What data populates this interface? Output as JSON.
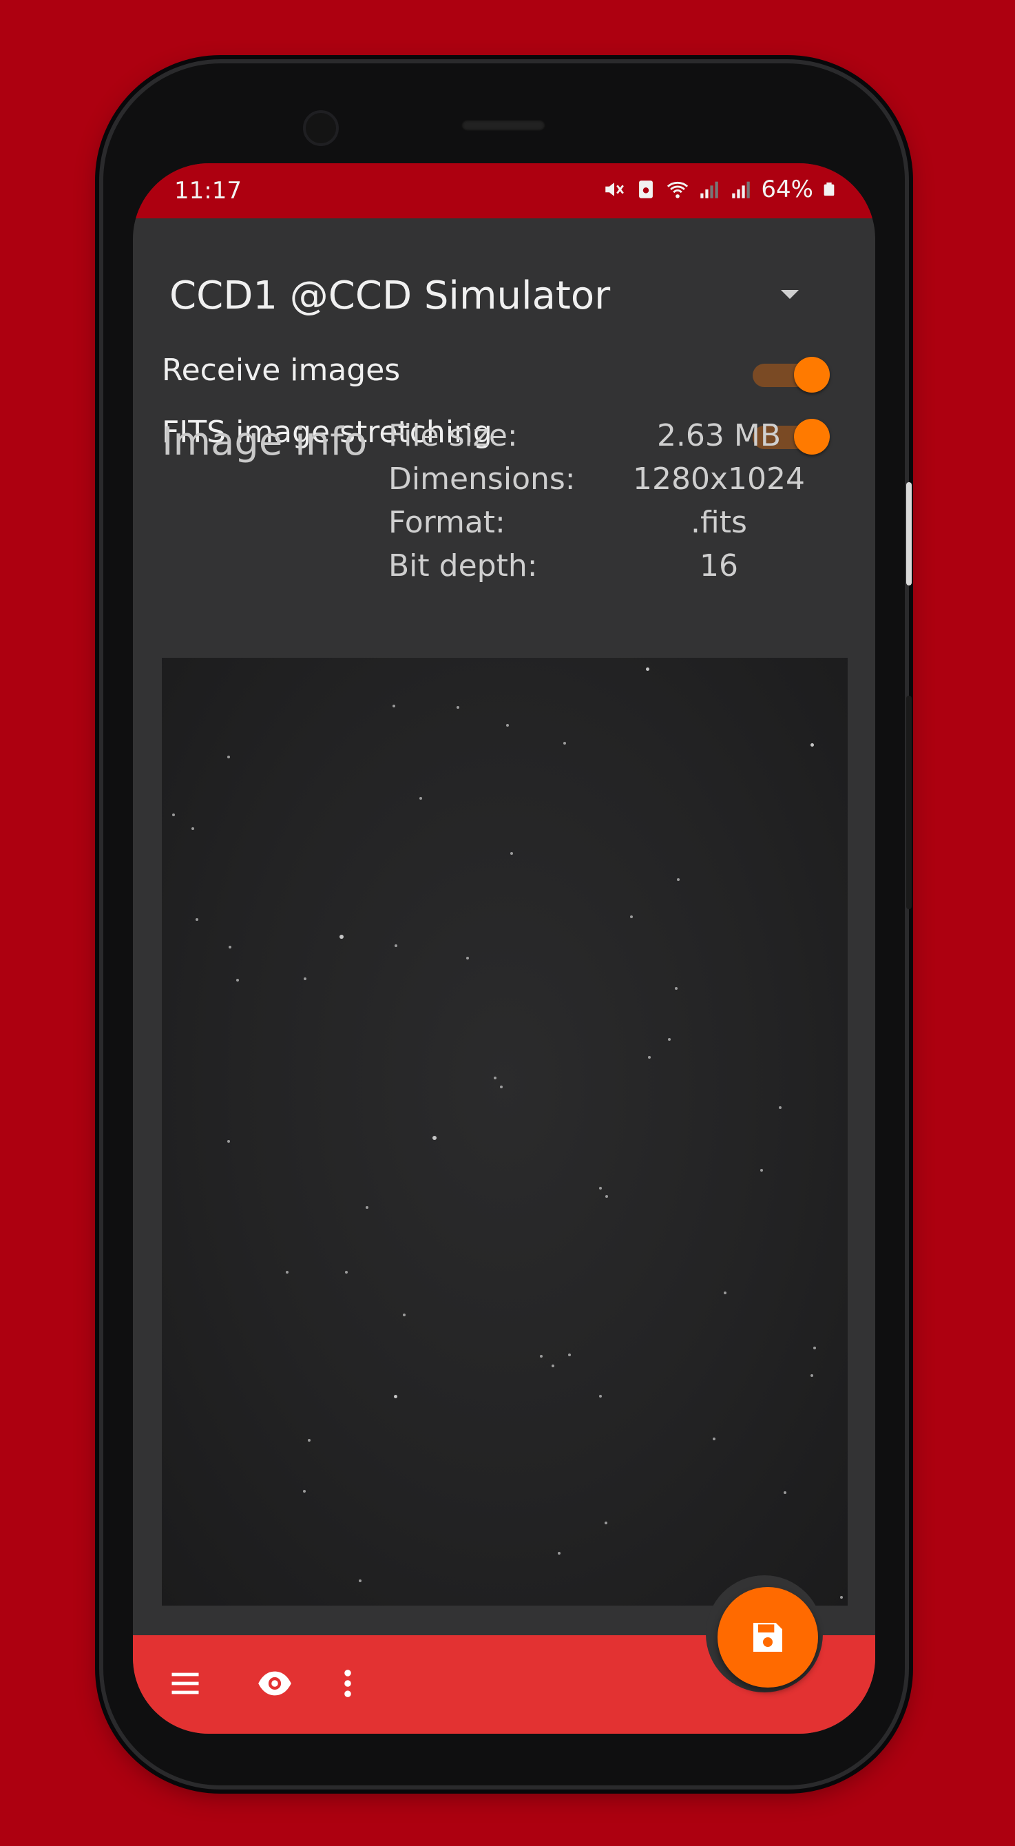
{
  "status_bar": {
    "time": "11:17",
    "battery": "64%"
  },
  "device_selector": {
    "selected": "CCD1 @CCD Simulator"
  },
  "toggles": [
    {
      "label": "Receive images",
      "on": true
    },
    {
      "label": "FITS image stretching",
      "on": true
    }
  ],
  "image_info": {
    "title": "Image info",
    "rows": [
      {
        "key": "File size:",
        "value": "2.63 MB"
      },
      {
        "key": "Dimensions:",
        "value": "1280x1024"
      },
      {
        "key": "Format:",
        "value": ".fits"
      },
      {
        "key": "Bit depth:",
        "value": "16"
      }
    ]
  },
  "icons": {
    "menu": "menu-icon",
    "view": "eye-icon",
    "more": "more-vertical-icon",
    "save": "save-icon"
  },
  "colors": {
    "accent": "#ff7a00",
    "bottom_bar": "#e33232",
    "status_bar": "#ad0010"
  }
}
